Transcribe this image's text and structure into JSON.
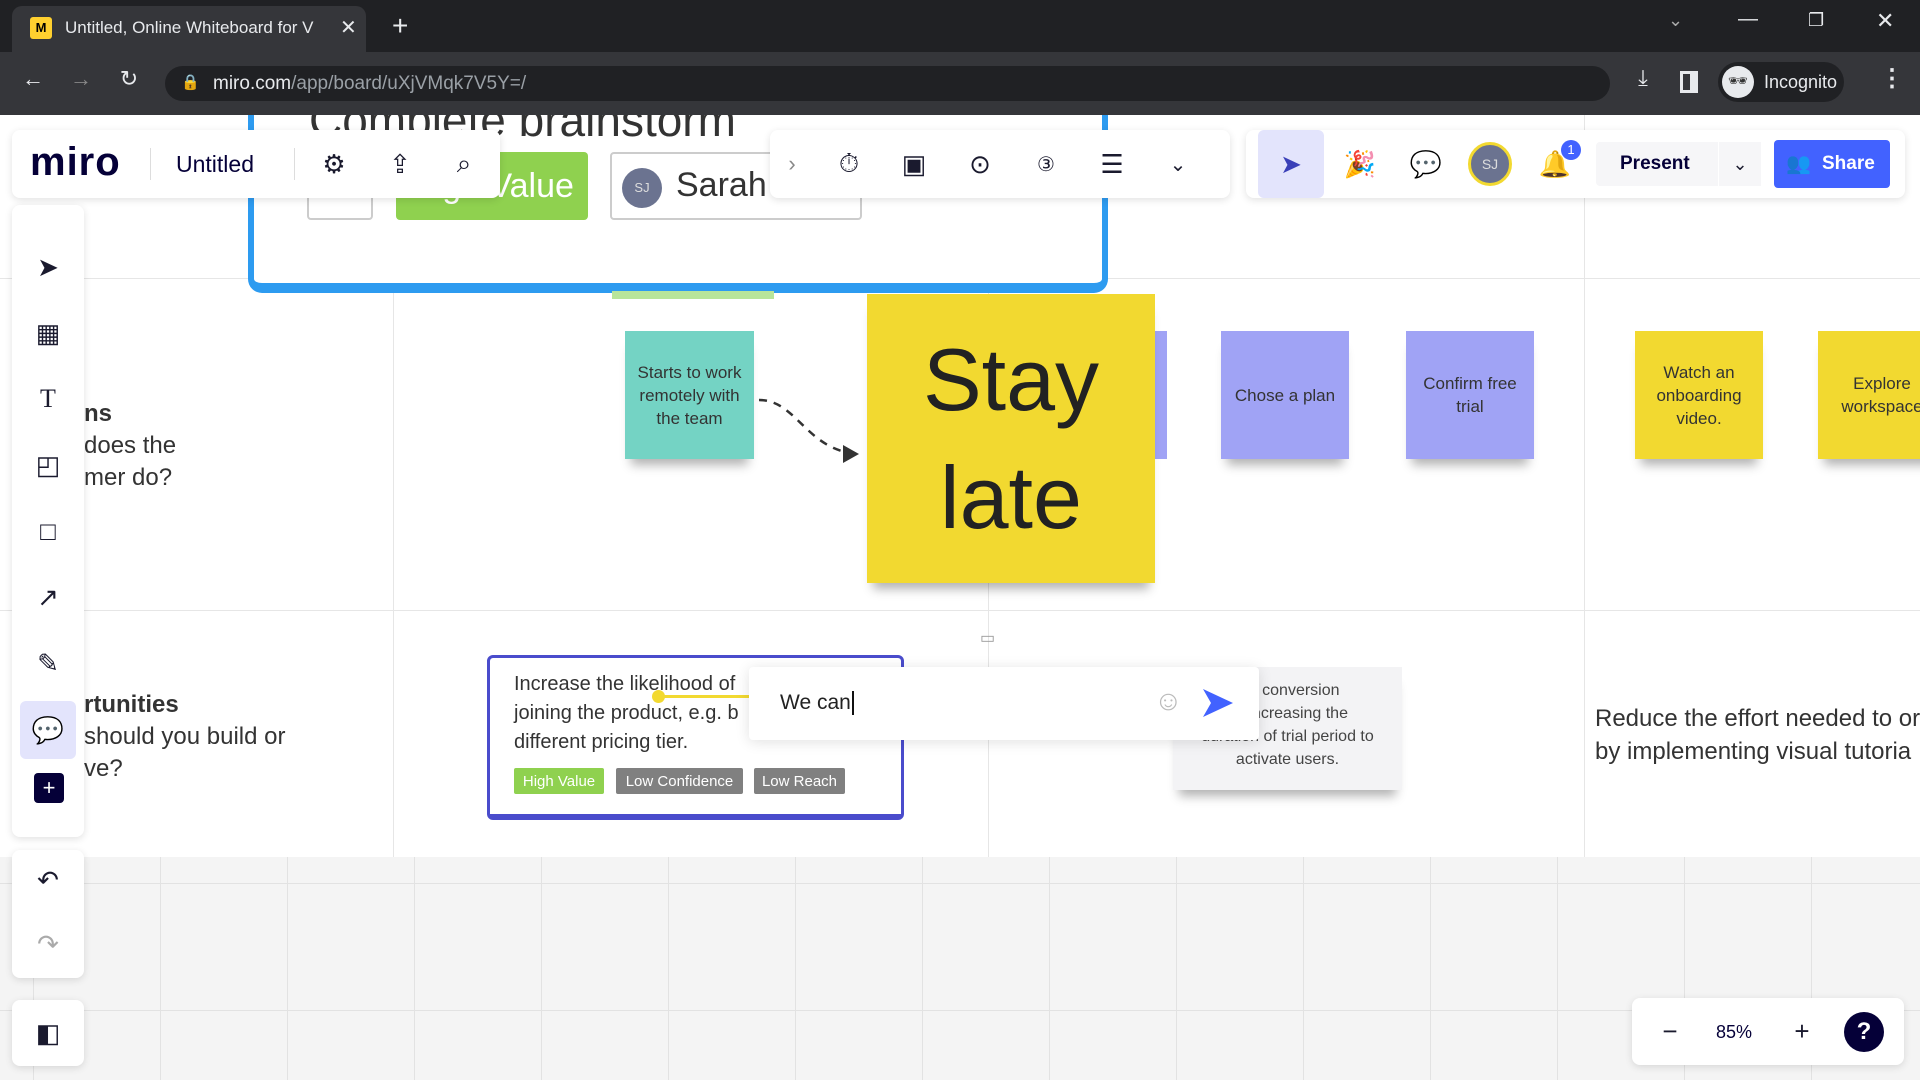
{
  "browser": {
    "tab_title": "Untitled, Online Whiteboard for V",
    "url_domain": "miro.com",
    "url_path": "/app/board/uXjVMqk7V5Y=/",
    "profile_label": "Incognito"
  },
  "header": {
    "logo": "miro",
    "board_title": "Untitled",
    "present_label": "Present",
    "share_label": "Share",
    "notification_count": "1",
    "avatar_initials": "SJ"
  },
  "card_top": {
    "title": "Complete brainstorm",
    "tag": "High Value",
    "assignee_initials": "SJ",
    "assignee": "Sarah Jonas"
  },
  "rows": [
    {
      "title": "ns",
      "lines": [
        "does the",
        "mer do?"
      ]
    },
    {
      "title": "rtunities",
      "lines": [
        "should you build or",
        "ve?"
      ]
    }
  ],
  "stickies": {
    "teal": "Starts to work remotely with the team",
    "big": "Stay late",
    "plan": "Chose a plan",
    "trial": "Confirm free trial",
    "video": "Watch an onboarding video.",
    "explore": "Explore workspace"
  },
  "opportunity": {
    "lines": [
      "Increase the likelihood of",
      "joining the product, e.g. b",
      "different pricing tier."
    ],
    "tags": [
      "High Value",
      "Low Confidence",
      "Low Reach"
    ]
  },
  "comment": {
    "value": "We can"
  },
  "gray_card": {
    "lines": [
      "the conversion",
      "by increasing the",
      "duration of trial period to",
      "activate users."
    ]
  },
  "right_text": {
    "lines": [
      "Reduce the effort needed to or",
      "by implementing visual tutoria"
    ]
  },
  "zoom": {
    "level": "85%"
  },
  "colors": {
    "accent": "#4262ff",
    "teal": "#74d3c4",
    "yellow": "#f2d930",
    "purple": "#a0a3f5",
    "green": "#8fd14f",
    "frame_blue": "#2d9bf0"
  }
}
